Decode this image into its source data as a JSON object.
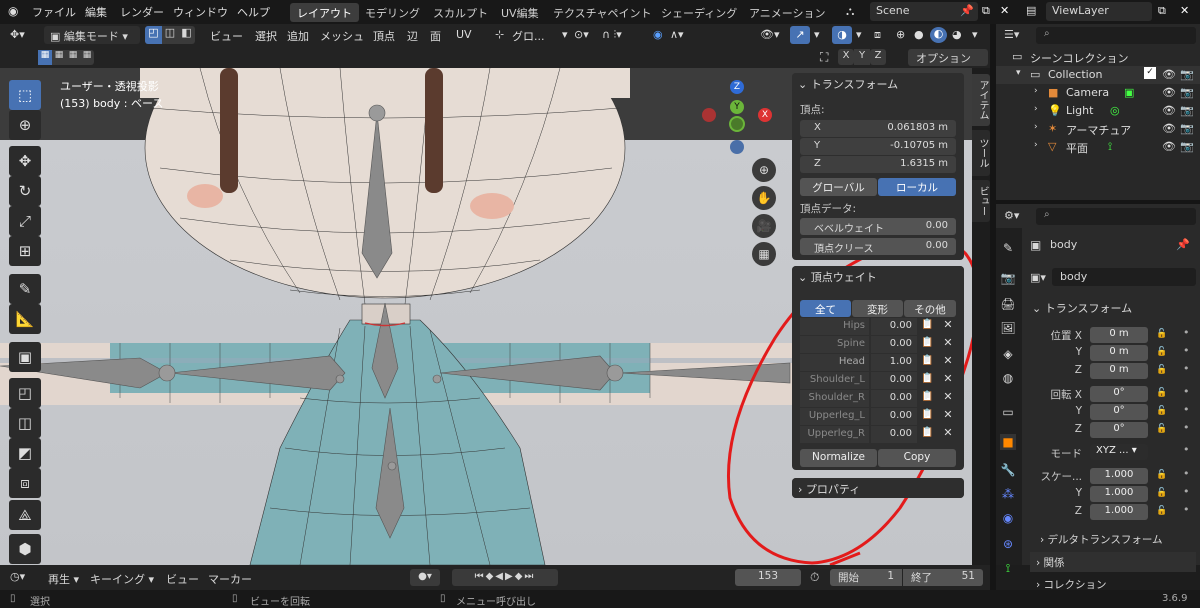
{
  "menu": {
    "file": "ファイル",
    "edit": "編集",
    "render": "レンダー",
    "window": "ウィンドウ",
    "help": "ヘルプ"
  },
  "workspaces": [
    "レイアウト",
    "モデリング",
    "スカルプト",
    "UV編集",
    "テクスチャペイント",
    "シェーディング",
    "アニメーション"
  ],
  "scene": {
    "name": "Scene",
    "view_layer": "ViewLayer"
  },
  "header": {
    "mode": "編集モード",
    "items": [
      "ビュー",
      "選択",
      "追加",
      "メッシュ",
      "頂点",
      "辺",
      "面",
      "UV"
    ],
    "transform_orient": "グロ...",
    "options": "オプション",
    "axes": [
      "X",
      "Y",
      "Z"
    ]
  },
  "viewport": {
    "view_name": "ユーザー・透視投影",
    "object_info": "(153) body : ベース"
  },
  "transform_panel": {
    "title": "トランスフォーム",
    "vertex_label": "頂点:",
    "x_label": "X",
    "x": "0.061803 m",
    "y_label": "Y",
    "y": "-0.10705 m",
    "z_label": "Z",
    "z": "1.6315 m",
    "global": "グローバル",
    "local": "ローカル",
    "vertex_data": "頂点データ:",
    "bevel_label": "ベベルウェイト",
    "bevel": "0.00",
    "crease_label": "頂点クリース",
    "crease": "0.00"
  },
  "weights_panel": {
    "title": "頂点ウェイト",
    "tab_all": "全て",
    "tab_deform": "変形",
    "tab_other": "その他",
    "rows": [
      {
        "name": "Hips",
        "value": "0.00"
      },
      {
        "name": "Spine",
        "value": "0.00"
      },
      {
        "name": "Head",
        "value": "1.00"
      },
      {
        "name": "Shoulder_L",
        "value": "0.00"
      },
      {
        "name": "Shoulder_R",
        "value": "0.00"
      },
      {
        "name": "Upperleg_L",
        "value": "0.00"
      },
      {
        "name": "Upperleg_R",
        "value": "0.00"
      }
    ],
    "normalize": "Normalize",
    "copy": "Copy"
  },
  "property_panel": {
    "title": "プロパティ"
  },
  "side_tabs": [
    "アイテム",
    "ツール",
    "ビュー"
  ],
  "outliner": {
    "root": "シーンコレクション",
    "collection": "Collection",
    "items": [
      "Camera",
      "Light",
      "アーマチュア",
      "平面"
    ]
  },
  "props": {
    "object_name": "body",
    "data_name": "body",
    "transform": "トランスフォーム",
    "loc_label": "位置 X",
    "rot_label": "回転 X",
    "y_label": "Y",
    "z_label": "Z",
    "loc": [
      "0 m",
      "0 m",
      "0 m"
    ],
    "rot": [
      "0°",
      "0°",
      "0°"
    ],
    "mode_label": "モード",
    "mode": "XYZ ...",
    "scale_label": "スケー...",
    "scale": [
      "1.000",
      "1.000",
      "1.000"
    ],
    "delta": "デルタトランスフォーム",
    "relations": "関係",
    "collections": "コレクション"
  },
  "timeline": {
    "playback": "再生",
    "keying": "キーイング",
    "view": "ビュー",
    "marker": "マーカー",
    "frame": "153",
    "start_label": "開始",
    "start": "1",
    "end_label": "終了",
    "end": "51"
  },
  "status": {
    "select": "選択",
    "rotate_view": "ビューを回転",
    "call_menu": "メニュー呼び出し",
    "version": "3.6.9"
  }
}
